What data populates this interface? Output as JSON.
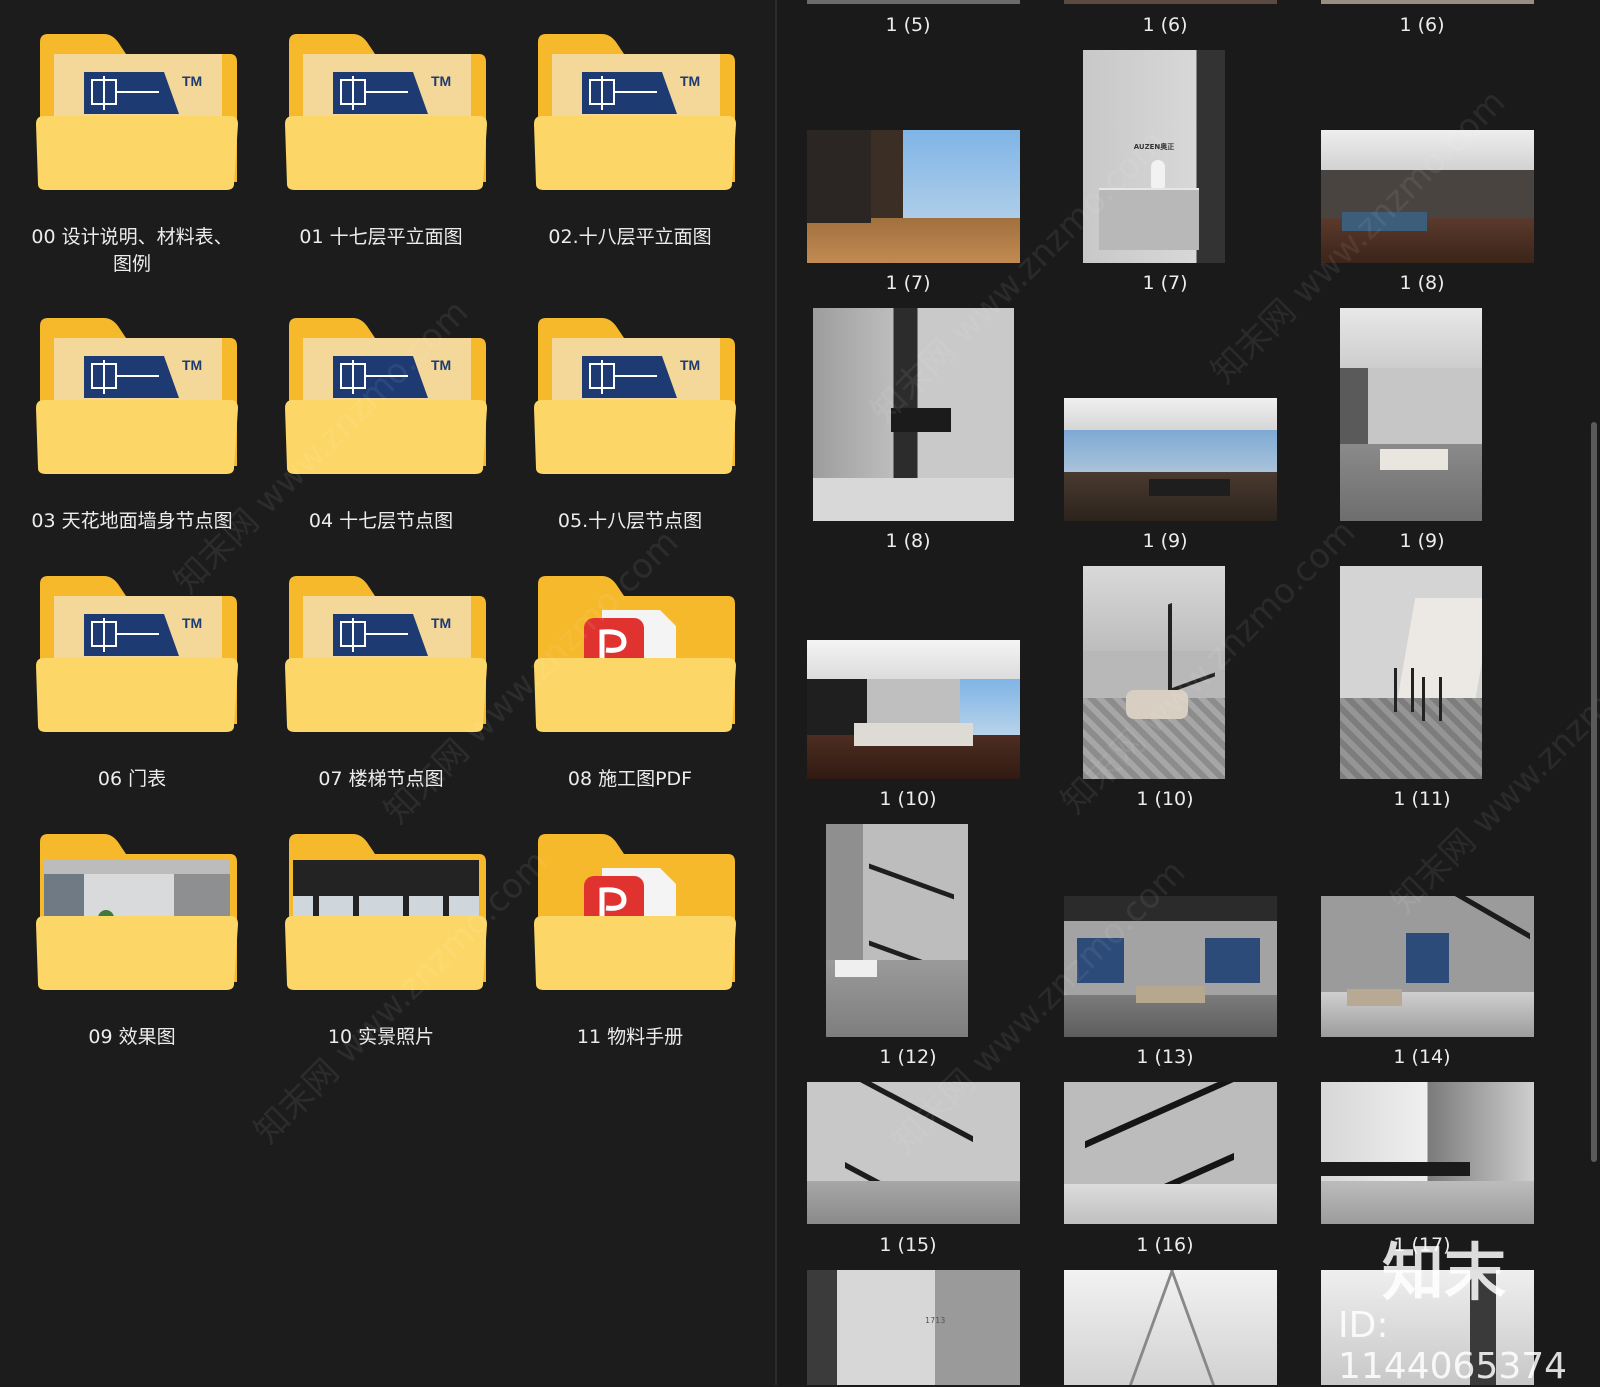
{
  "left_pane": {
    "folders": [
      {
        "label": "00  设计说明、材料表、\n图例",
        "icon": "cad-folder-icon"
      },
      {
        "label": "01 十七层平立面图",
        "icon": "cad-folder-icon"
      },
      {
        "label": "02.十八层平立面图",
        "icon": "cad-folder-icon"
      },
      {
        "label": "03 天花地面墙身节点图",
        "icon": "cad-folder-icon"
      },
      {
        "label": "04 十七层节点图",
        "icon": "cad-folder-icon"
      },
      {
        "label": "05.十八层节点图",
        "icon": "cad-folder-icon"
      },
      {
        "label": "06 门表",
        "icon": "cad-folder-icon"
      },
      {
        "label": "07 楼梯节点图",
        "icon": "cad-folder-icon"
      },
      {
        "label": "08 施工图PDF",
        "icon": "pdf-folder-icon"
      },
      {
        "label": "09 效果图",
        "icon": "image-folder-icon"
      },
      {
        "label": "10 实景照片",
        "icon": "image-folder-icon"
      },
      {
        "label": "11 物料手册",
        "icon": "pdf-folder-icon"
      }
    ],
    "cad_badge": "TM"
  },
  "right_pane": {
    "thumbnails": [
      {
        "caption": "1 (5)"
      },
      {
        "caption": "1 (6)"
      },
      {
        "caption": "1 (6)"
      },
      {
        "caption": "1 (7)"
      },
      {
        "caption": "1 (7)"
      },
      {
        "caption": "1 (8)"
      },
      {
        "caption": "1 (8)"
      },
      {
        "caption": "1 (9)"
      },
      {
        "caption": "1 (9)"
      },
      {
        "caption": "1 (10)"
      },
      {
        "caption": "1 (10)"
      },
      {
        "caption": "1 (11)"
      },
      {
        "caption": "1 (12)"
      },
      {
        "caption": "1 (13)"
      },
      {
        "caption": "1 (14)"
      },
      {
        "caption": "1 (15)"
      },
      {
        "caption": "1 (16)"
      },
      {
        "caption": "1 (17)"
      }
    ],
    "reception_sign": "AUZEN奥正",
    "room_number": "1713"
  },
  "watermark": {
    "logo": "知末",
    "id_text": "ID: 1144065374",
    "diagonal": "知末网 www.znzmo.com"
  },
  "colors": {
    "background": "#1b1b1b",
    "folder_back": "#f5b92b",
    "folder_front": "#fcd767",
    "cad_blue": "#1d3a73",
    "pdf_red": "#e0332f"
  }
}
